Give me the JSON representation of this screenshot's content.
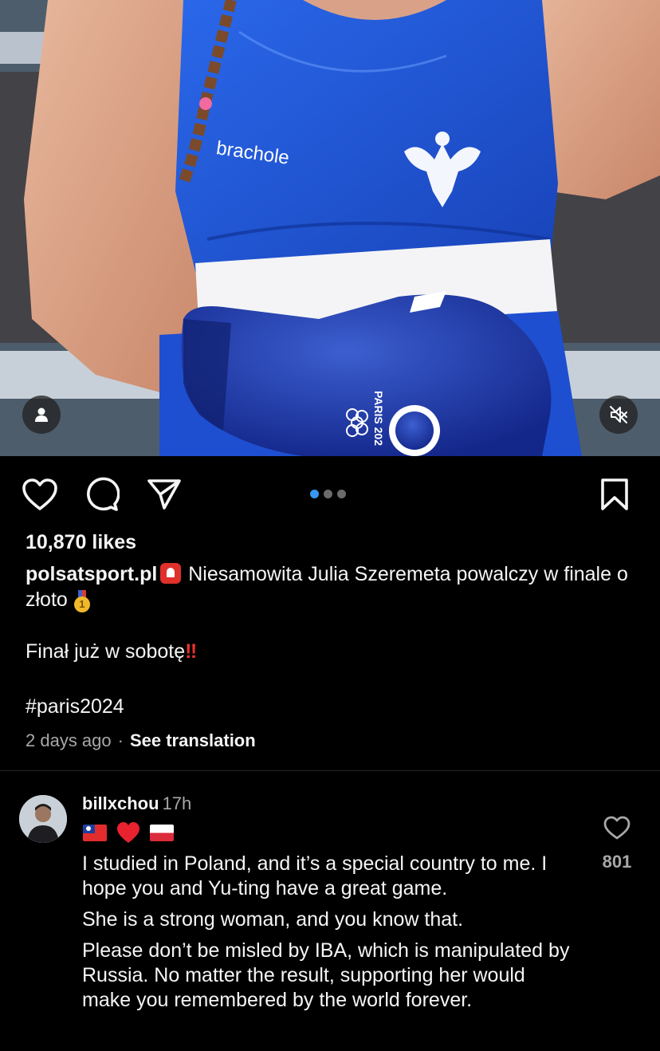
{
  "post": {
    "likes": "10,870 likes",
    "username": "polsatsport.pl",
    "caption_line1": " Niesamowita Julia Szeremeta powalczy w finale o złoto",
    "caption_line2": "Finał już w sobotę",
    "caption_line2_emoji": "‼",
    "hashtag": "#paris2024",
    "time": "2 days ago",
    "separator": "·",
    "see_translation": "See translation",
    "carousel": {
      "count": 3,
      "active_index": 0
    }
  },
  "media": {
    "jersey_text": "brachole",
    "glove_text": "PARIS 202"
  },
  "comment": {
    "username": "billxchou",
    "time": "17h",
    "paragraphs": [
      "I studied in Poland, and it’s a special country to me. I hope you and Yu-ting have a great game.",
      "She is a strong woman, and you know that.",
      "Please don’t be misled by IBA, which is manipulated by Russia. No matter the result, supporting her would make you remembered by the world forever."
    ],
    "like_count": "801"
  },
  "icons": {
    "like": "heart-outline-icon",
    "comment": "comment-bubble-icon",
    "share": "paper-plane-icon",
    "save": "bookmark-icon",
    "user": "user-tag-icon",
    "mute": "speaker-muted-icon"
  },
  "colors": {
    "background": "#000000",
    "text": "#f5f5f5",
    "secondary_text": "#a8a8a8",
    "accent_blue": "#3897f0",
    "jersey_blue": "#1f55d6"
  }
}
